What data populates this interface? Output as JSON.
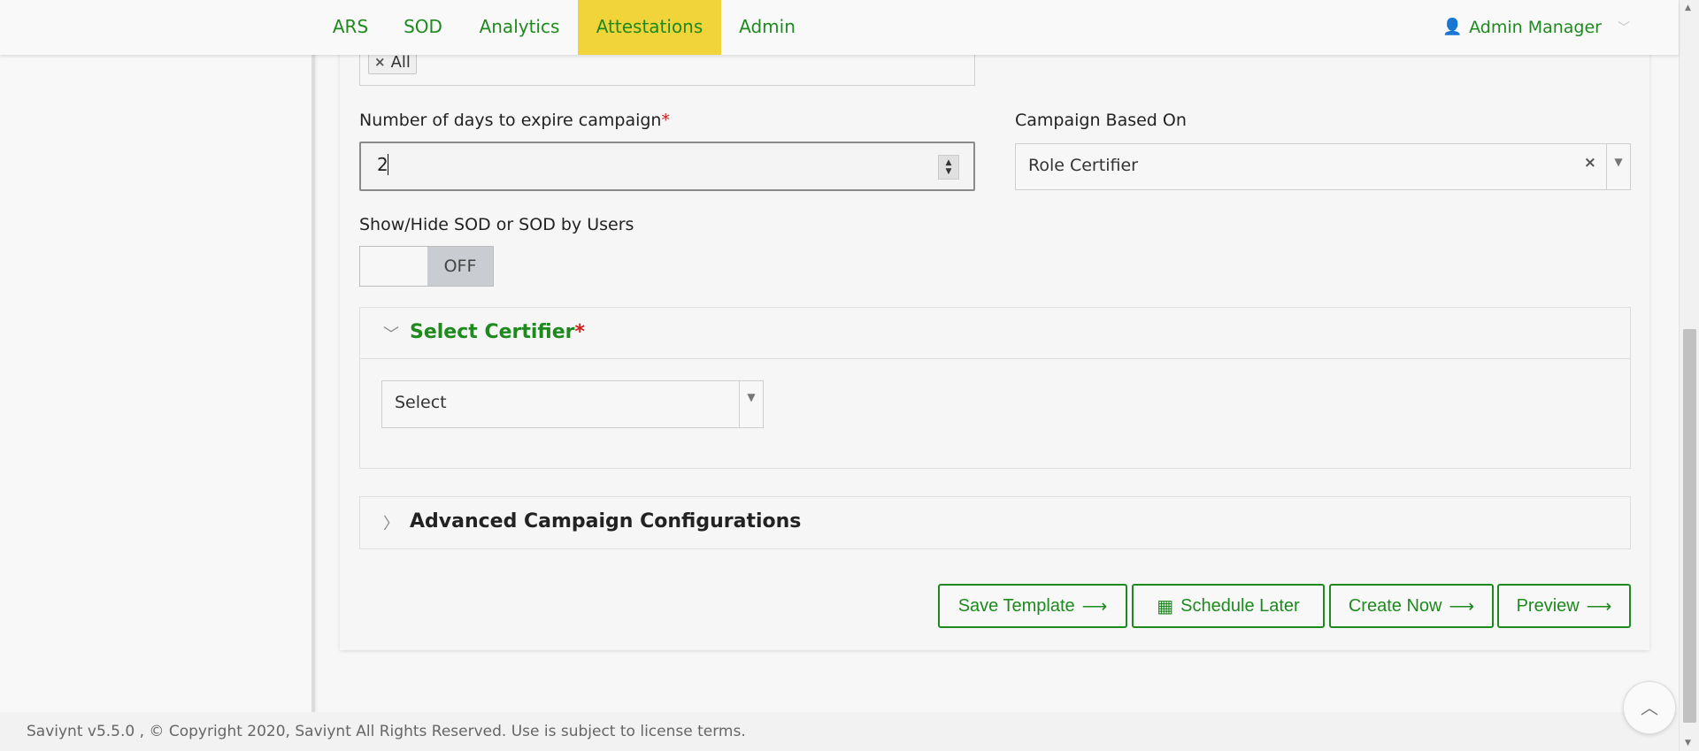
{
  "nav": {
    "items": [
      {
        "label": "ARS",
        "active": false
      },
      {
        "label": "SOD",
        "active": false
      },
      {
        "label": "Analytics",
        "active": false
      },
      {
        "label": "Attestations",
        "active": true
      },
      {
        "label": "Admin",
        "active": false
      }
    ],
    "user_name": "Admin Manager",
    "active_color": "#f0d43a",
    "link_color": "#1e8a1e"
  },
  "form": {
    "chip_label": "All",
    "days_label": "Number of days to expire campaign",
    "days_required": "*",
    "days_value": "2",
    "based_on_label": "Campaign Based On",
    "based_on_value": "Role Certifier",
    "toggle_label": "Show/Hide SOD or SOD by Users",
    "toggle_state": "OFF"
  },
  "certifier": {
    "title": "Select Certifier",
    "required": "*",
    "select_placeholder": "Select"
  },
  "advanced": {
    "title": "Advanced Campaign Configurations"
  },
  "actions": {
    "save_template": "Save Template",
    "schedule_later": "Schedule Later",
    "create_now": "Create Now",
    "preview": "Preview"
  },
  "footer": {
    "text": "Saviynt v5.5.0 , © Copyright  2020, Saviynt All Rights Reserved. Use is subject to license terms."
  }
}
